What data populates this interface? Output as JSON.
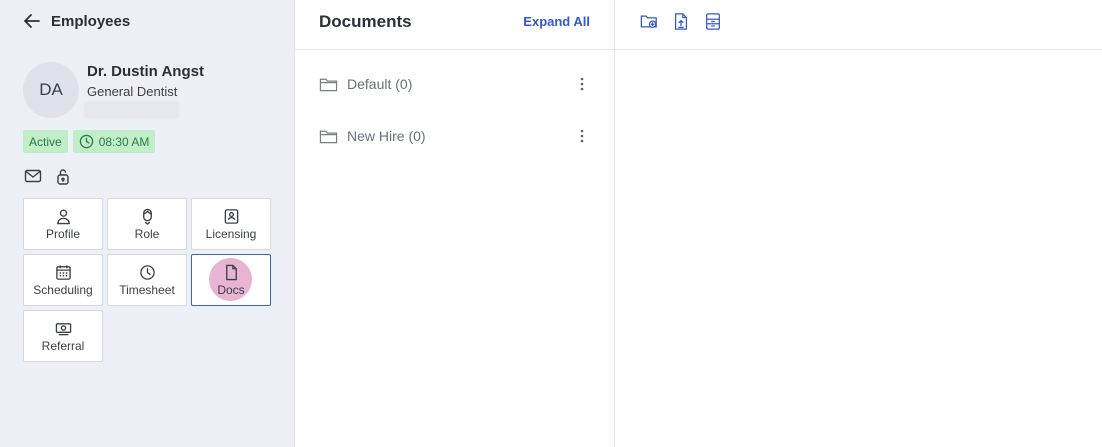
{
  "header": {
    "back_label": "Employees"
  },
  "employee": {
    "initials": "DA",
    "name": "Dr. Dustin Angst",
    "title": "General Dentist",
    "status": "Active",
    "clock_time": "08:30 AM"
  },
  "tiles": {
    "profile": "Profile",
    "role": "Role",
    "licensing": "Licensing",
    "scheduling": "Scheduling",
    "timesheet": "Timesheet",
    "docs": "Docs",
    "referral": "Referral"
  },
  "documents": {
    "title": "Documents",
    "expand_all": "Expand All",
    "folders": [
      {
        "label": "Default (0)"
      },
      {
        "label": "New Hire (0)"
      }
    ]
  },
  "colors": {
    "accent": "#3459c7",
    "status_bg": "#bfeec9",
    "status_text": "#2f7a44",
    "sidebar_bg": "#eef0f7",
    "docs_highlight": "#e8b4d3"
  },
  "icons": {
    "back": "arrow-left-icon",
    "email": "mail-icon",
    "lock": "unlock-icon",
    "new_folder": "folder-plus-icon",
    "upload": "file-upload-icon",
    "archive": "archive-icon"
  }
}
